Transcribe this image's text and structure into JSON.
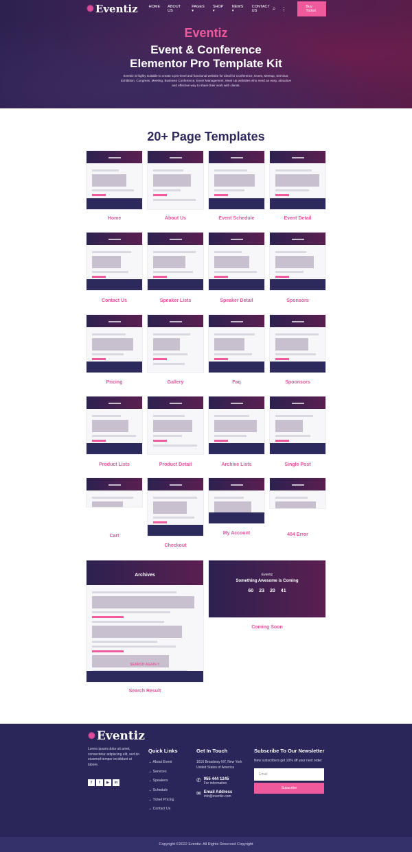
{
  "nav": {
    "brand": "Eventiz",
    "items": [
      "HOME",
      "ABOUT US",
      "PAGES ▾",
      "SHOP ▾",
      "NEWS ▾",
      "CONTACT US"
    ],
    "buy": "Buy Ticket"
  },
  "hero": {
    "brand": "Eventiz",
    "title1": "Event & Conference",
    "title2": "Elementor Pro Template Kit",
    "desc": "Eventiz is highly suitable to create a pro-level and functional website for ideal for Conference, Event, Meetup, Seminar, Exhibition, Congress, Meeting, Business Conference, Event Management, Meet Up websites who need an easy, attractive and effective way to share their work with clients."
  },
  "section_title": "20+ Page Templates",
  "templates": [
    "Home",
    "About Us",
    "Event Schedule",
    "Event Detail",
    "Contact Us",
    "Speaker Lists",
    "Speaker Detail",
    "Sponsors",
    "Pricing",
    "Gallery",
    "Faq",
    "Spoonsors",
    "Product Lists",
    "Product Detail",
    "Archive Lists",
    "Single Post",
    "Cart",
    "Checkout",
    "My Account",
    "404 Error",
    "Search Result",
    "Coming Soon"
  ],
  "thumb_text": {
    "archives": "Archives",
    "search_again": "SEARCH AGAIN !!",
    "coming_brand": "Eventiz",
    "coming_title": "Something Awesome is Coming",
    "countdown": [
      "60",
      "23",
      "20",
      "41"
    ]
  },
  "footer": {
    "brand": "Eventiz",
    "about": "Lorem ipsum dolor sit amet, consectetur adipiscing elit, sed do eiusmod tempor incididunt ut labore.",
    "social": [
      "f",
      "t",
      "▶",
      "in"
    ],
    "quick_title": "Quick Links",
    "quick_links": [
      "About Event",
      "Services",
      "Speakers",
      "Schedule",
      "Ticket Pricing",
      "Contact Us"
    ],
    "touch_title": "Get In Touch",
    "address": "1616 Broadway NY, New York United States of America",
    "phone": "955 444 1245",
    "phone_sub": "For information",
    "email_title": "Email Address",
    "email": "info@eventiz.com",
    "news_title": "Subscribe To Our Newsletter",
    "news_desc": "New subscribers get 10% off your next order",
    "email_placeholder": "Email",
    "subscribe": "Subscribe"
  },
  "copyright": "Copyright ©2022 Eventiz. All Rights Reserved Copyright",
  "colors": {
    "accent": "#ee5a9c",
    "navy": "#2a2659"
  }
}
